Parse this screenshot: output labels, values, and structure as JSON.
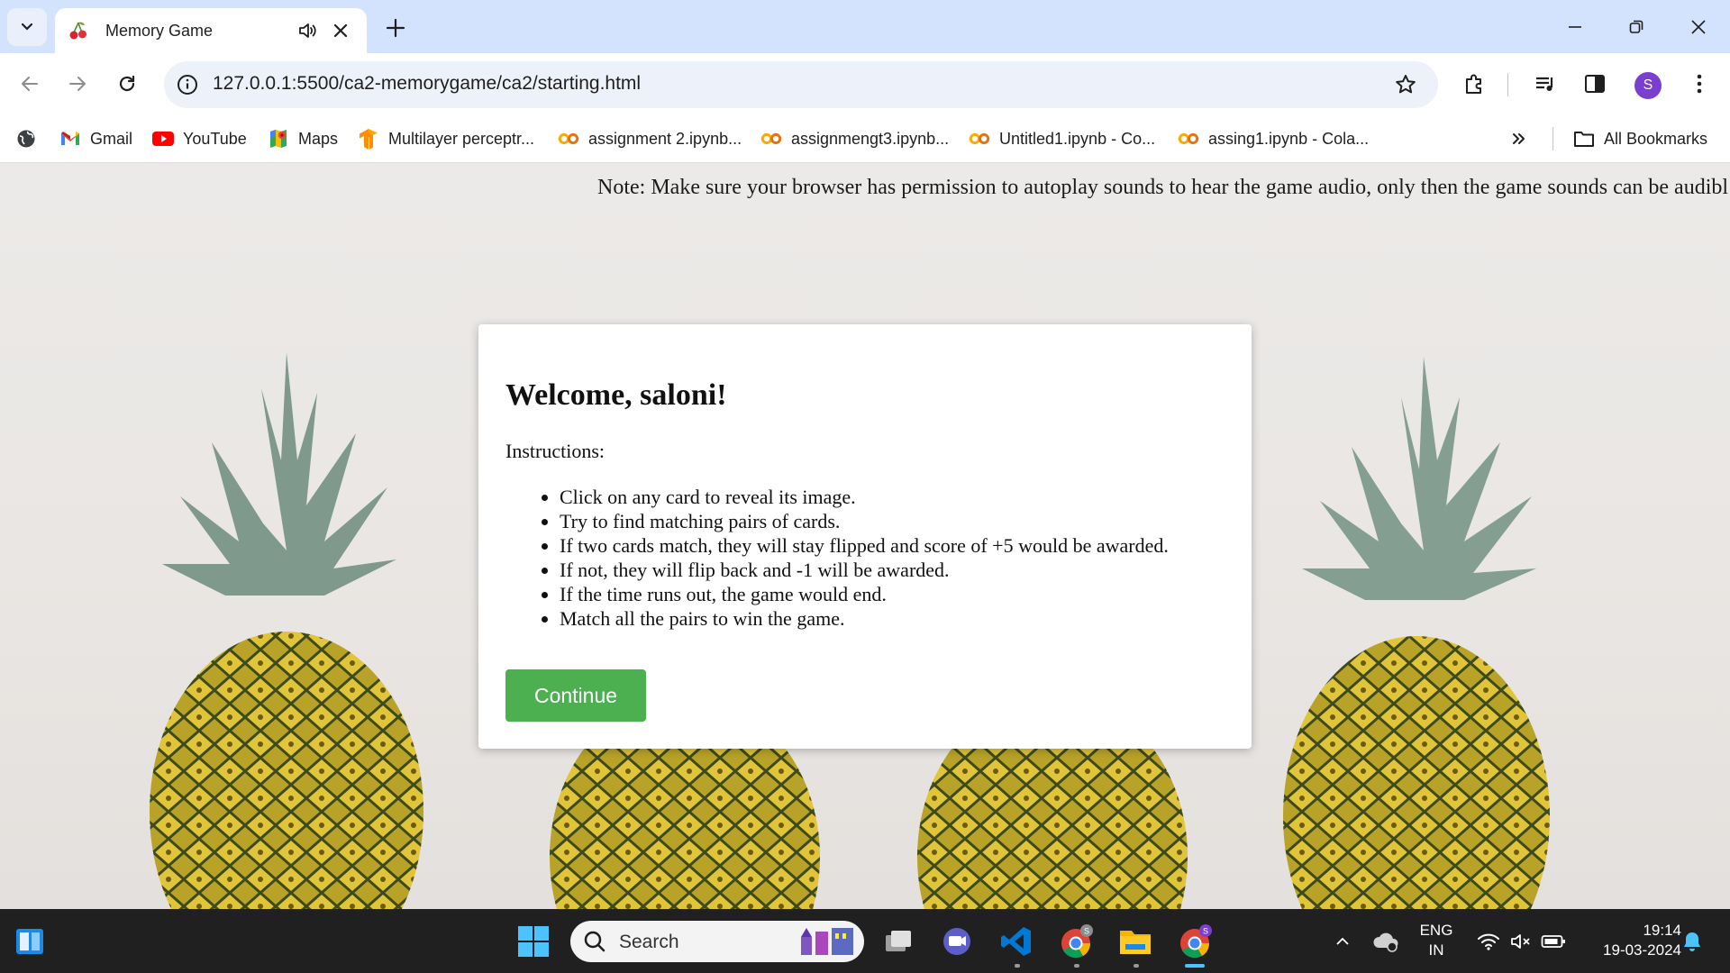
{
  "browser": {
    "tab": {
      "title": "Memory Game",
      "favicon": "cherry-icon"
    },
    "url": "127.0.0.1:5500/ca2-memorygame/ca2/starting.html",
    "profile_initial": "S",
    "bookmarks": [
      {
        "label": "Gmail",
        "icon": "gmail-icon"
      },
      {
        "label": "YouTube",
        "icon": "youtube-icon"
      },
      {
        "label": "Maps",
        "icon": "maps-icon"
      },
      {
        "label": "Multilayer perceptr...",
        "icon": "tensorflow-icon"
      },
      {
        "label": "assignment 2.ipynb...",
        "icon": "colab-icon"
      },
      {
        "label": "assignmengt3.ipynb...",
        "icon": "colab-icon"
      },
      {
        "label": "Untitled1.ipynb - Co...",
        "icon": "colab-icon"
      },
      {
        "label": "assing1.ipynb - Cola...",
        "icon": "colab-icon"
      }
    ],
    "all_bookmarks": "All Bookmarks"
  },
  "page": {
    "note": "Note: Make sure your browser has permission to autoplay sounds to hear the game audio, only then the game sounds can be audibl",
    "modal": {
      "heading": "Welcome, saloni!",
      "instructions_label": "Instructions:",
      "instructions": [
        "Click on any card to reveal its image.",
        "Try to find matching pairs of cards.",
        "If two cards match, they will stay flipped and score of +5 would be awarded.",
        "If not, they will flip back and -1 will be awarded.",
        "If the time runs out, the game would end.",
        "Match all the pairs to win the game."
      ],
      "continue_label": "Continue"
    }
  },
  "taskbar": {
    "search_label": "Search",
    "language": "ENG",
    "region": "IN",
    "time": "19:14",
    "date": "19-03-2024"
  },
  "colors": {
    "continue_button": "#4caf50",
    "tabstrip": "#d3e3fd",
    "taskbar": "#202020"
  }
}
